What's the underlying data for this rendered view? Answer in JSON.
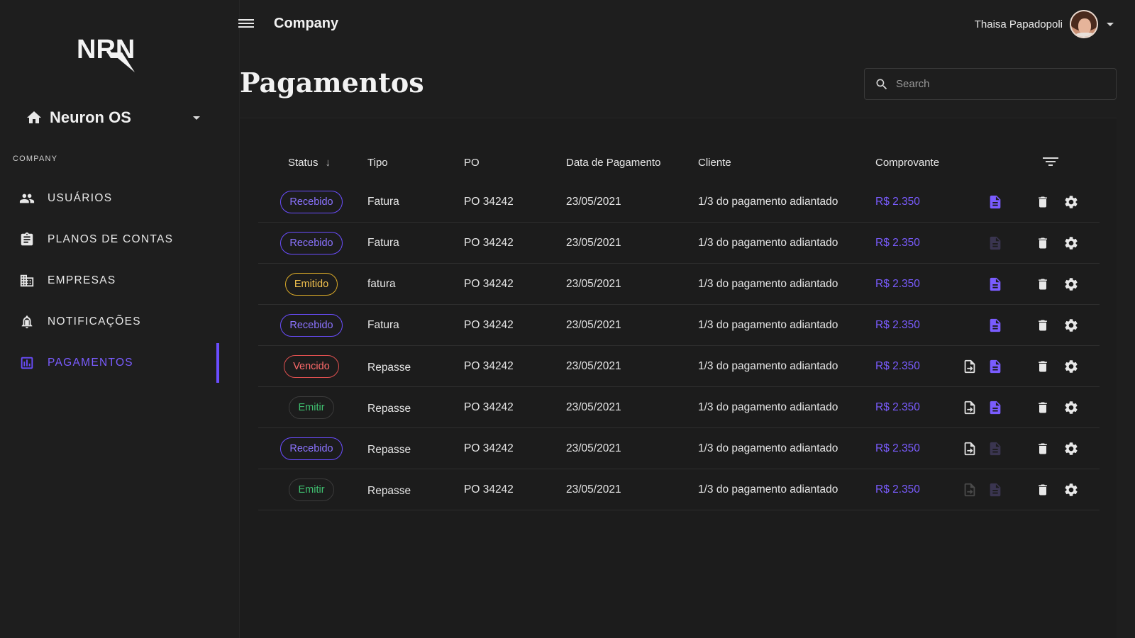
{
  "sidebar": {
    "logo_text": "NRN",
    "workspace": "Neuron OS",
    "section_label": "COMPANY",
    "items": [
      {
        "label": "USUÁRIOS",
        "icon": "users-icon"
      },
      {
        "label": "PLANOS DE CONTAS",
        "icon": "clipboard-icon"
      },
      {
        "label": "EMPRESAS",
        "icon": "building-icon"
      },
      {
        "label": "NOTIFICAÇÕES",
        "icon": "bell-icon"
      },
      {
        "label": "PAGAMENTOS",
        "icon": "bar-chart-icon",
        "active": true
      }
    ]
  },
  "header": {
    "title": "Company",
    "user_name": "Thaisa Papadopoli"
  },
  "page": {
    "title": "Pagamentos",
    "search_placeholder": "Search"
  },
  "table": {
    "columns": {
      "status": "Status",
      "tipo": "Tipo",
      "po": "PO",
      "data": "Data de Pagamento",
      "cliente": "Cliente",
      "comprovante": "Comprovante"
    },
    "rows": [
      {
        "status": "Recebido",
        "status_kind": "recebido",
        "tipo": "Fatura",
        "po": "PO 34242",
        "data": "23/05/2021",
        "cliente": "1/3 do pagamento adiantado",
        "valor": "R$ 2.350",
        "upload": "none",
        "doc": "active"
      },
      {
        "status": "Recebido",
        "status_kind": "recebido",
        "tipo": "Fatura",
        "po": "PO 34242",
        "data": "23/05/2021",
        "cliente": "1/3 do pagamento adiantado",
        "valor": "R$ 2.350",
        "upload": "none",
        "doc": "dim"
      },
      {
        "status": "Emitido",
        "status_kind": "emitido",
        "tipo": "fatura",
        "po": "PO 34242",
        "data": "23/05/2021",
        "cliente": "1/3 do pagamento adiantado",
        "valor": "R$ 2.350",
        "upload": "none",
        "doc": "active"
      },
      {
        "status": "Recebido",
        "status_kind": "recebido",
        "tipo": "Fatura",
        "po": "PO 34242",
        "data": "23/05/2021",
        "cliente": "1/3 do pagamento adiantado",
        "valor": "R$ 2.350",
        "upload": "none",
        "doc": "active"
      },
      {
        "status": "Vencido",
        "status_kind": "vencido",
        "tipo": "Repasse",
        "po": "PO 34242",
        "data": "23/05/2021",
        "cliente": "1/3 do pagamento adiantado",
        "valor": "R$ 2.350",
        "upload": "active",
        "doc": "active"
      },
      {
        "status": "Emitir",
        "status_kind": "emitir",
        "tipo": "Repasse",
        "po": "PO 34242",
        "data": "23/05/2021",
        "cliente": "1/3 do pagamento adiantado",
        "valor": "R$ 2.350",
        "upload": "active",
        "doc": "active"
      },
      {
        "status": "Recebido",
        "status_kind": "recebido",
        "tipo": "Repasse",
        "po": "PO 34242",
        "data": "23/05/2021",
        "cliente": "1/3 do pagamento adiantado",
        "valor": "R$ 2.350",
        "upload": "active",
        "doc": "dim"
      },
      {
        "status": "Emitir",
        "status_kind": "emitir",
        "tipo": "Repasse",
        "po": "PO 34242",
        "data": "23/05/2021",
        "cliente": "1/3 do pagamento adiantado",
        "valor": "R$ 2.350",
        "upload": "dim",
        "doc": "dim"
      }
    ]
  },
  "colors": {
    "accent": "#6a4dff",
    "accent_text": "#7a5cff",
    "doc_active": "#7a5cff",
    "doc_dim": "#3a3550",
    "upload_active": "#e0e0e0",
    "upload_dim": "#4a4a4a",
    "background": "#1e1e1e"
  }
}
